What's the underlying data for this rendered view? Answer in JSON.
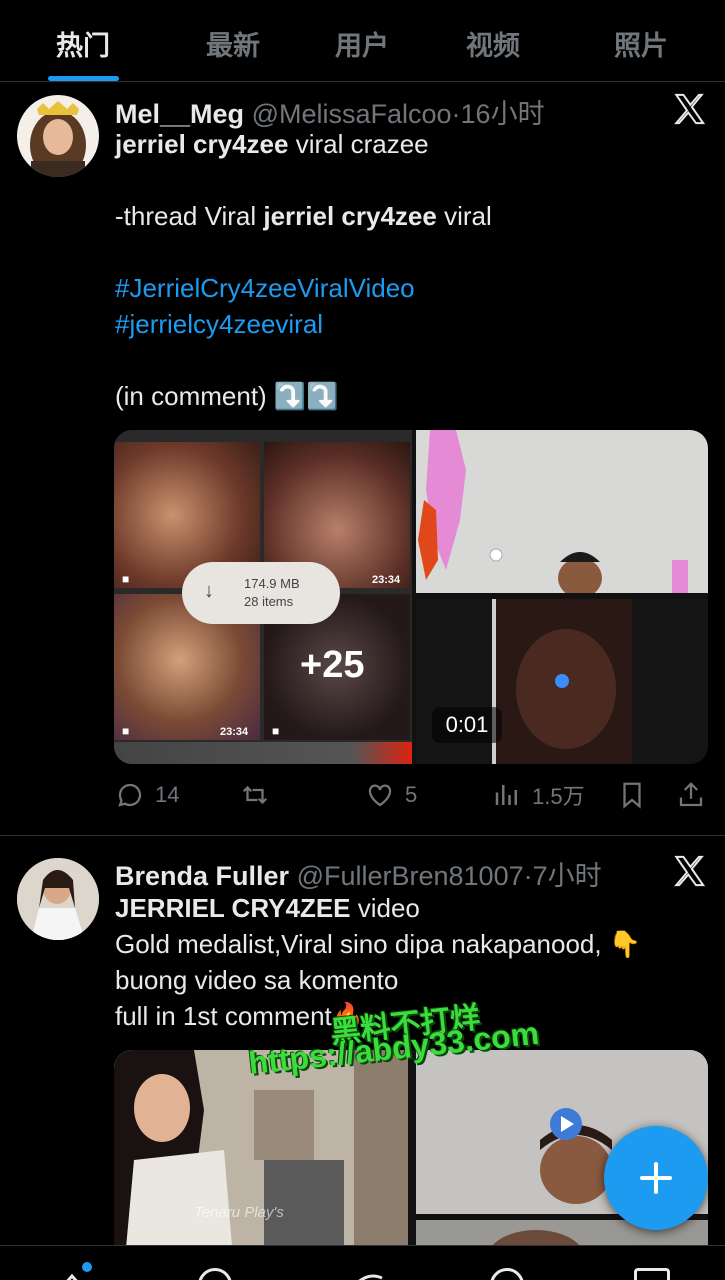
{
  "tabs": [
    {
      "label": "热门",
      "active": true
    },
    {
      "label": "最新",
      "active": false
    },
    {
      "label": "用户",
      "active": false
    },
    {
      "label": "视频",
      "active": false
    },
    {
      "label": "照片",
      "active": false
    }
  ],
  "tweets": [
    {
      "name": "Mel__Meg",
      "handle": "@MelissaFalcoo",
      "separator": "·",
      "time": "16小时",
      "lines": [
        {
          "bold": "jerriel cry4zee",
          "rest": " viral crazee"
        },
        {
          "pre": "-thread Viral ",
          "bold": "jerriel cry4zee",
          "rest": " viral"
        },
        {
          "tag": "#JerrielCry4zeeViralVideo"
        },
        {
          "tag": "#jerrielcy4zeeviral"
        },
        {
          "pre": "(in comment) ⤵️⤵️"
        }
      ],
      "media": {
        "download_size": "174.9 MB",
        "download_items": "28 items",
        "plus_count": "+25",
        "duration_a": "23:34",
        "duration_b": "23:34",
        "video_duration": "0:01"
      },
      "actions": {
        "replies": "14",
        "retweets": "",
        "likes": "5",
        "views": "1.5万"
      }
    },
    {
      "name": "Brenda Fuller",
      "handle": "@FullerBren81007",
      "separator": "·",
      "time": "7小时",
      "lines": [
        {
          "bold": "JERRIEL CRY4ZEE",
          "rest": " video"
        },
        {
          "pre": " Gold medalist,Viral sino dipa nakapanood, 👇"
        },
        {
          "pre": "buong video sa komento"
        },
        {
          "pre": "full in 1st comment🔥"
        }
      ],
      "media": {
        "caption": "Tenaru Play's"
      }
    }
  ],
  "watermark": {
    "line1": "黑料不打烊",
    "line2": "https://abdy33.com"
  },
  "colors": {
    "accent": "#1d9bf0",
    "text": "#e7e9ea",
    "muted": "#71767b",
    "background": "#000000",
    "divider": "#2f3336"
  },
  "icons": [
    "x-logo-icon",
    "reply-icon",
    "retweet-icon",
    "like-icon",
    "views-icon",
    "bookmark-icon",
    "share-icon",
    "plus-icon",
    "download-icon",
    "play-icon",
    "video-camera-icon"
  ]
}
